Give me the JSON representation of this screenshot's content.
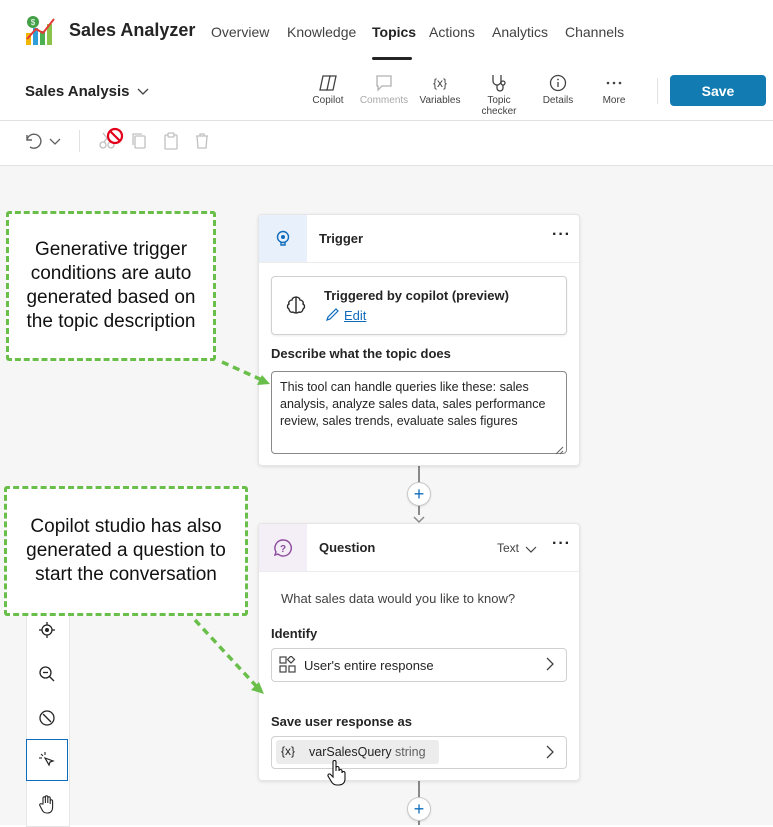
{
  "app": {
    "title": "Sales Analyzer"
  },
  "nav": {
    "items": [
      {
        "label": "Overview"
      },
      {
        "label": "Knowledge"
      },
      {
        "label": "Topics"
      },
      {
        "label": "Actions"
      },
      {
        "label": "Analytics"
      },
      {
        "label": "Channels"
      }
    ],
    "active": "Topics"
  },
  "topic": {
    "name": "Sales Analysis"
  },
  "toolbar": {
    "copilot": "Copilot",
    "comments": "Comments",
    "variables": "Variables",
    "topic_checker": "Topic checker",
    "details": "Details",
    "more": "More",
    "save_label": "Save"
  },
  "trigger_card": {
    "title": "Trigger",
    "trigger_type": "Triggered by copilot (preview)",
    "edit_label": "Edit",
    "describe_label": "Describe what the topic does",
    "description": "This tool can handle queries like these: sales analysis, analyze sales data, sales performance review, sales trends, evaluate sales figures"
  },
  "question_card": {
    "title": "Question",
    "response_type": "Text",
    "prompt": "What sales data would you like to know?",
    "identify_label": "Identify",
    "identify_value": "User's entire response",
    "save_label": "Save user response as",
    "var_prefix": "{x}",
    "var_name": "varSalesQuery",
    "var_type": "string"
  },
  "callouts": {
    "trigger": "Generative trigger conditions are auto generated based on the topic description",
    "question": "Copilot studio has also generated a question to start the conversation"
  },
  "colors": {
    "save_button": "#117bb2",
    "callout_border": "#6abf4b",
    "accent_blue": "#0f6cbd"
  }
}
